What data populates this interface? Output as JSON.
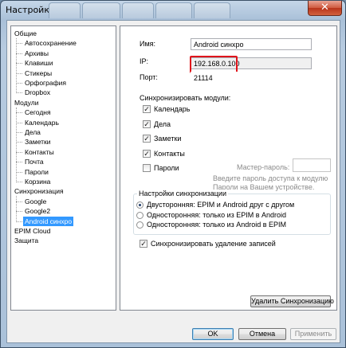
{
  "window": {
    "title": "Настройки",
    "close_glyph": "✕",
    "background_tabs": [
      "",
      "",
      "",
      "",
      ""
    ]
  },
  "tree": {
    "items": [
      {
        "label": "Общие",
        "level": 0
      },
      {
        "label": "Автосохранение",
        "level": 1
      },
      {
        "label": "Архивы",
        "level": 1
      },
      {
        "label": "Клавиши",
        "level": 1
      },
      {
        "label": "Стикеры",
        "level": 1
      },
      {
        "label": "Орфография",
        "level": 1
      },
      {
        "label": "Dropbox",
        "level": 1
      },
      {
        "label": "Модули",
        "level": 0
      },
      {
        "label": "Сегодня",
        "level": 1
      },
      {
        "label": "Календарь",
        "level": 1
      },
      {
        "label": "Дела",
        "level": 1
      },
      {
        "label": "Заметки",
        "level": 1
      },
      {
        "label": "Контакты",
        "level": 1
      },
      {
        "label": "Почта",
        "level": 1
      },
      {
        "label": "Пароли",
        "level": 1
      },
      {
        "label": "Корзина",
        "level": 1
      },
      {
        "label": "Синхронизация",
        "level": 0
      },
      {
        "label": "Google",
        "level": 1
      },
      {
        "label": "Google2",
        "level": 1
      },
      {
        "label": "Android синхро",
        "level": 1,
        "selected": true
      },
      {
        "label": "EPIM Cloud",
        "level": 0
      },
      {
        "label": "Защита",
        "level": 0
      }
    ]
  },
  "form": {
    "name_label": "Имя:",
    "name_value": "Android синхро",
    "ip_label": "IP:",
    "ip_value": "192.168.0.100",
    "port_label": "Порт:",
    "port_value": "21114",
    "sync_modules_label": "Синхронизировать модули:",
    "modules": [
      {
        "label": "Календарь",
        "checked": true
      },
      {
        "label": "Дела",
        "checked": true
      },
      {
        "label": "Заметки",
        "checked": true
      },
      {
        "label": "Контакты",
        "checked": true
      },
      {
        "label": "Пароли",
        "checked": false
      }
    ],
    "master_password_label": "Мастер-пароль:",
    "master_password_value": "",
    "master_password_hint_1": "Введите пароль доступа к модулю",
    "master_password_hint_2": "Пароли на Вашем устройстве.",
    "sync_settings_label": "Настройки синхронизации",
    "sync_options": [
      {
        "label": "Двусторонняя: EPIM и Android друг с другом",
        "checked": true
      },
      {
        "label": "Односторонняя: только из EPIM в Android",
        "checked": false
      },
      {
        "label": "Односторонняя: только из Android в EPIM",
        "checked": false
      }
    ],
    "sync_delete_label": "Синхронизировать удаление записей",
    "sync_delete_checked": true,
    "delete_sync_button": "Удалить Синхронизацию"
  },
  "footer": {
    "ok": "OK",
    "cancel": "Отмена",
    "apply": "Применить"
  },
  "colors": {
    "selection": "#3399ff",
    "highlight_border": "#e0141b"
  }
}
